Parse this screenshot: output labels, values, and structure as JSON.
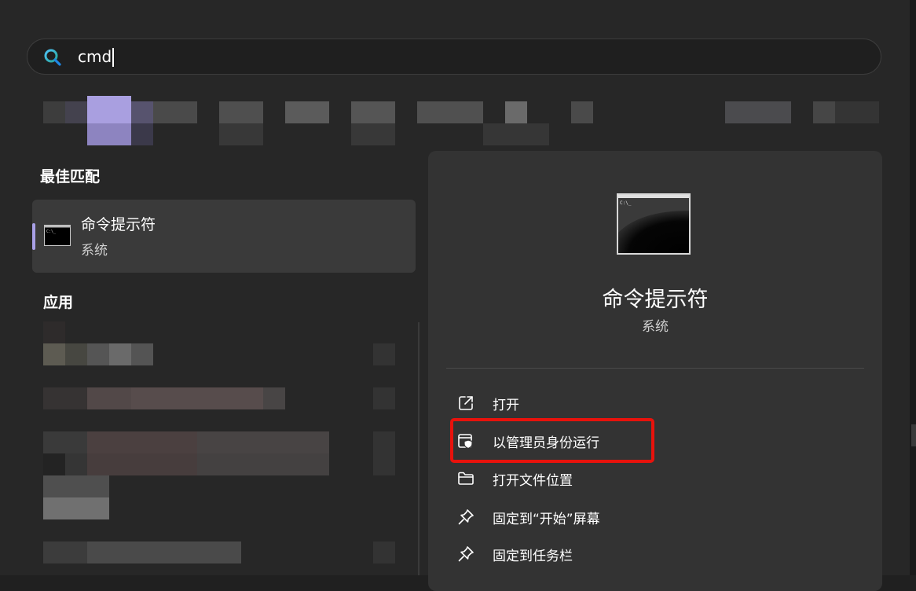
{
  "search": {
    "value": "cmd",
    "icon": "search-icon"
  },
  "best_match": {
    "section_title": "最佳匹配",
    "item": {
      "name": "命令提示符",
      "subtitle": "系统",
      "icon": "command-prompt-icon"
    }
  },
  "apps": {
    "section_title": "应用"
  },
  "detail": {
    "title": "命令提示符",
    "subtitle": "系统",
    "icon": "command-prompt-icon",
    "icon_text": "C:\\_",
    "actions": [
      {
        "label": "打开",
        "icon": "open-external-icon"
      },
      {
        "label": "以管理员身份运行",
        "icon": "run-as-admin-icon",
        "highlighted": true
      },
      {
        "label": "打开文件位置",
        "icon": "folder-icon"
      },
      {
        "label": "固定到“开始”屏幕",
        "icon": "pin-icon"
      },
      {
        "label": "固定到任务栏",
        "icon": "pin-icon"
      }
    ]
  },
  "colors": {
    "accent": "#a8a0e6",
    "highlight_box": "#e8120c",
    "panel_bg": "#272727",
    "card_bg": "#3a3a3a"
  }
}
